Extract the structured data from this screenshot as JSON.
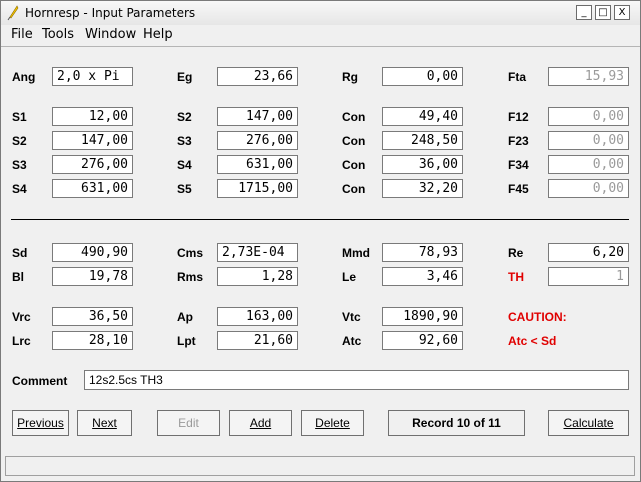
{
  "window": {
    "title": "Hornresp - Input Parameters",
    "controls": [
      "_",
      "□",
      "X"
    ]
  },
  "menu": [
    "File",
    "Tools",
    "Window",
    "Help"
  ],
  "rows": {
    "r1": [
      {
        "label": "Ang",
        "value": "2,0 x Pi"
      },
      {
        "label": "Eg",
        "value": "23,66"
      },
      {
        "label": "Rg",
        "value": "0,00"
      },
      {
        "label": "Fta",
        "value": "15,93"
      }
    ],
    "r2": [
      {
        "label": "S1",
        "value": "12,00"
      },
      {
        "label": "S2",
        "value": "147,00"
      },
      {
        "label": "Con",
        "value": "49,40"
      },
      {
        "label": "F12",
        "value": "0,00"
      }
    ],
    "r3": [
      {
        "label": "S2",
        "value": "147,00"
      },
      {
        "label": "S3",
        "value": "276,00"
      },
      {
        "label": "Con",
        "value": "248,50"
      },
      {
        "label": "F23",
        "value": "0,00"
      }
    ],
    "r4": [
      {
        "label": "S3",
        "value": "276,00"
      },
      {
        "label": "S4",
        "value": "631,00"
      },
      {
        "label": "Con",
        "value": "36,00"
      },
      {
        "label": "F34",
        "value": "0,00"
      }
    ],
    "r5": [
      {
        "label": "S4",
        "value": "631,00"
      },
      {
        "label": "S5",
        "value": "1715,00"
      },
      {
        "label": "Con",
        "value": "32,20"
      },
      {
        "label": "F45",
        "value": "0,00"
      }
    ],
    "r6": [
      {
        "label": "Sd",
        "value": "490,90"
      },
      {
        "label": "Cms",
        "value": "2,73E-04"
      },
      {
        "label": "Mmd",
        "value": "78,93"
      },
      {
        "label": "Re",
        "value": "6,20"
      }
    ],
    "r7": [
      {
        "label": "Bl",
        "value": "19,78"
      },
      {
        "label": "Rms",
        "value": "1,28"
      },
      {
        "label": "Le",
        "value": "3,46"
      },
      {
        "label": "TH",
        "value": "1"
      }
    ],
    "r8": [
      {
        "label": "Vrc",
        "value": "36,50"
      },
      {
        "label": "Ap",
        "value": "163,00"
      },
      {
        "label": "Vtc",
        "value": "1890,90"
      }
    ],
    "r9": [
      {
        "label": "Lrc",
        "value": "28,10"
      },
      {
        "label": "Lpt",
        "value": "21,60"
      },
      {
        "label": "Atc",
        "value": "92,60"
      }
    ]
  },
  "caution": {
    "line1": "CAUTION:",
    "line2": "Atc < Sd"
  },
  "comment": {
    "label": "Comment",
    "value": "12s2.5cs TH3"
  },
  "buttons": {
    "previous": "Previous",
    "next": "Next",
    "edit": "Edit",
    "add": "Add",
    "delete": "Delete",
    "calculate": "Calculate"
  },
  "record": "Record 10 of 11",
  "colors": {
    "warning": "#e00000"
  }
}
